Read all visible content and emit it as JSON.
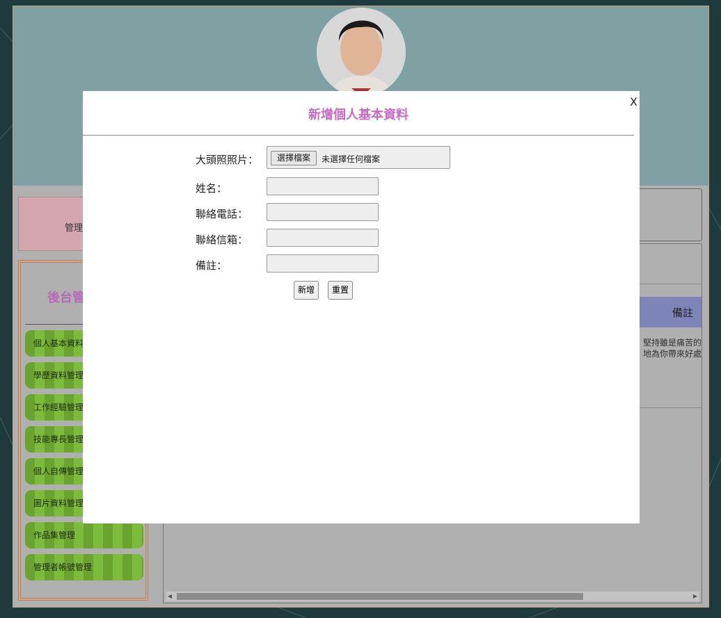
{
  "sidebar": {
    "login_text": "管理",
    "title": "後台管",
    "items": [
      {
        "label": "個人基本資料"
      },
      {
        "label": "學歷資料管理"
      },
      {
        "label": "工作經驗管理"
      },
      {
        "label": "技能專長管理"
      },
      {
        "label": "個人自傳管理"
      },
      {
        "label": "圖片資料管理"
      },
      {
        "label": "作品集管理"
      },
      {
        "label": "管理者帳號管理"
      }
    ]
  },
  "table": {
    "header_note": "備註",
    "cell_note_line1": "堅持雖是痛苦的",
    "cell_note_line2": "地為你帶來好處"
  },
  "modal": {
    "close_label": "X",
    "title": "新增個人基本資料",
    "fields": {
      "photo_label": "大頭照照片：",
      "file_button": "選擇檔案",
      "file_status": "未選擇任何檔案",
      "name_label": "姓名：",
      "phone_label": "聯絡電話：",
      "email_label": "聯絡信箱：",
      "note_label": "備註："
    },
    "submit_label": "新增",
    "reset_label": "重置"
  },
  "colors": {
    "modal_title": "#c86ac4",
    "header_band": "#7fa1a3",
    "table_header": "#7d85b8",
    "menu_item": "#6aa32e"
  }
}
